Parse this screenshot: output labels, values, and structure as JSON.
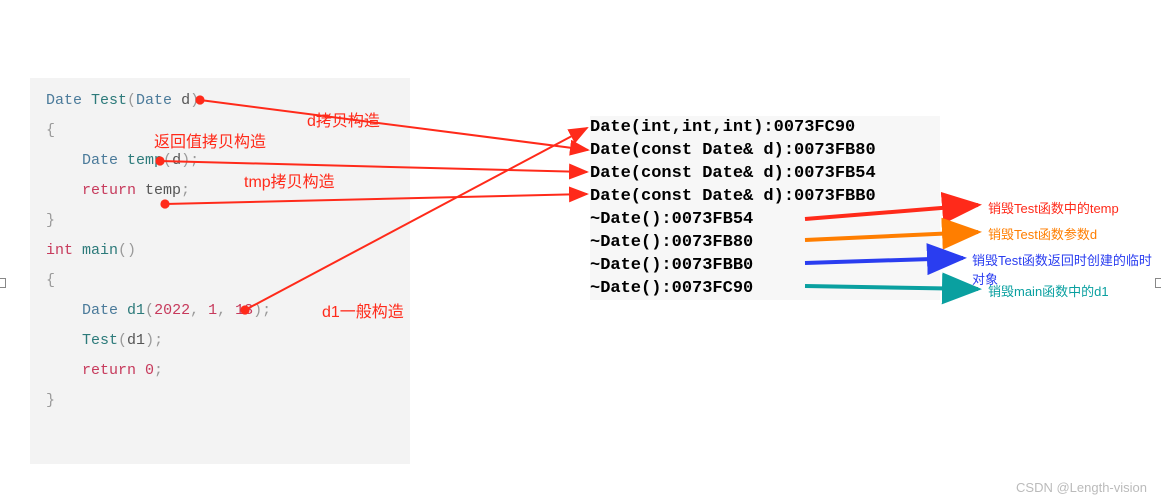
{
  "code": {
    "l1": "Date Test(Date d)",
    "l2": "{",
    "l3": "    Date temp(d);",
    "l4": "    return temp;",
    "l5": "}",
    "l6": "int main()",
    "l7": "{",
    "l8": "    Date d1(2022, 1, 13);",
    "l9": "    Test(d1);",
    "l10": "    return 0;",
    "l11": "}",
    "t_Date": "Date ",
    "t_Test": "Test",
    "t_parenL": "(",
    "t_Date2": "Date ",
    "t_d": "d",
    "t_parenR": ")",
    "t_braceL": "{",
    "t_ind": "    ",
    "t_temp": "temp",
    "t_semid": ";",
    "t_return": "return ",
    "t_braceR": "}",
    "t_int": "int ",
    "t_main": "main",
    "t_parens": "()",
    "t_d1": "d1",
    "t_args": "(2022, 1, 13)",
    "t_2022": "2022",
    "t_c": ", ",
    "t_1": "1",
    "t_13": "13",
    "t_0": "0"
  },
  "output": {
    "l1": "Date(int,int,int):0073FC90",
    "l2": "Date(const Date& d):0073FB80",
    "l3": "Date(const Date& d):0073FB54",
    "l4": "Date(const Date& d):0073FBB0",
    "l5": "~Date():0073FB54",
    "l6": "~Date():0073FB80",
    "l7": "~Date():0073FBB0",
    "l8": "~Date():0073FC90"
  },
  "annot": {
    "d_copy": "d拷贝构造",
    "ret_copy": "返回值拷贝构造",
    "tmp_copy": "tmp拷贝构造",
    "d1_ctor": "d1一般构造",
    "del_temp": "销毁Test函数中的temp",
    "del_param": "销毁Test函数参数d",
    "del_ret": "销毁Test函数返回时创建的临时对象",
    "del_d1": "销毁main函数中的d1"
  },
  "watermark": "CSDN @Length-vision"
}
